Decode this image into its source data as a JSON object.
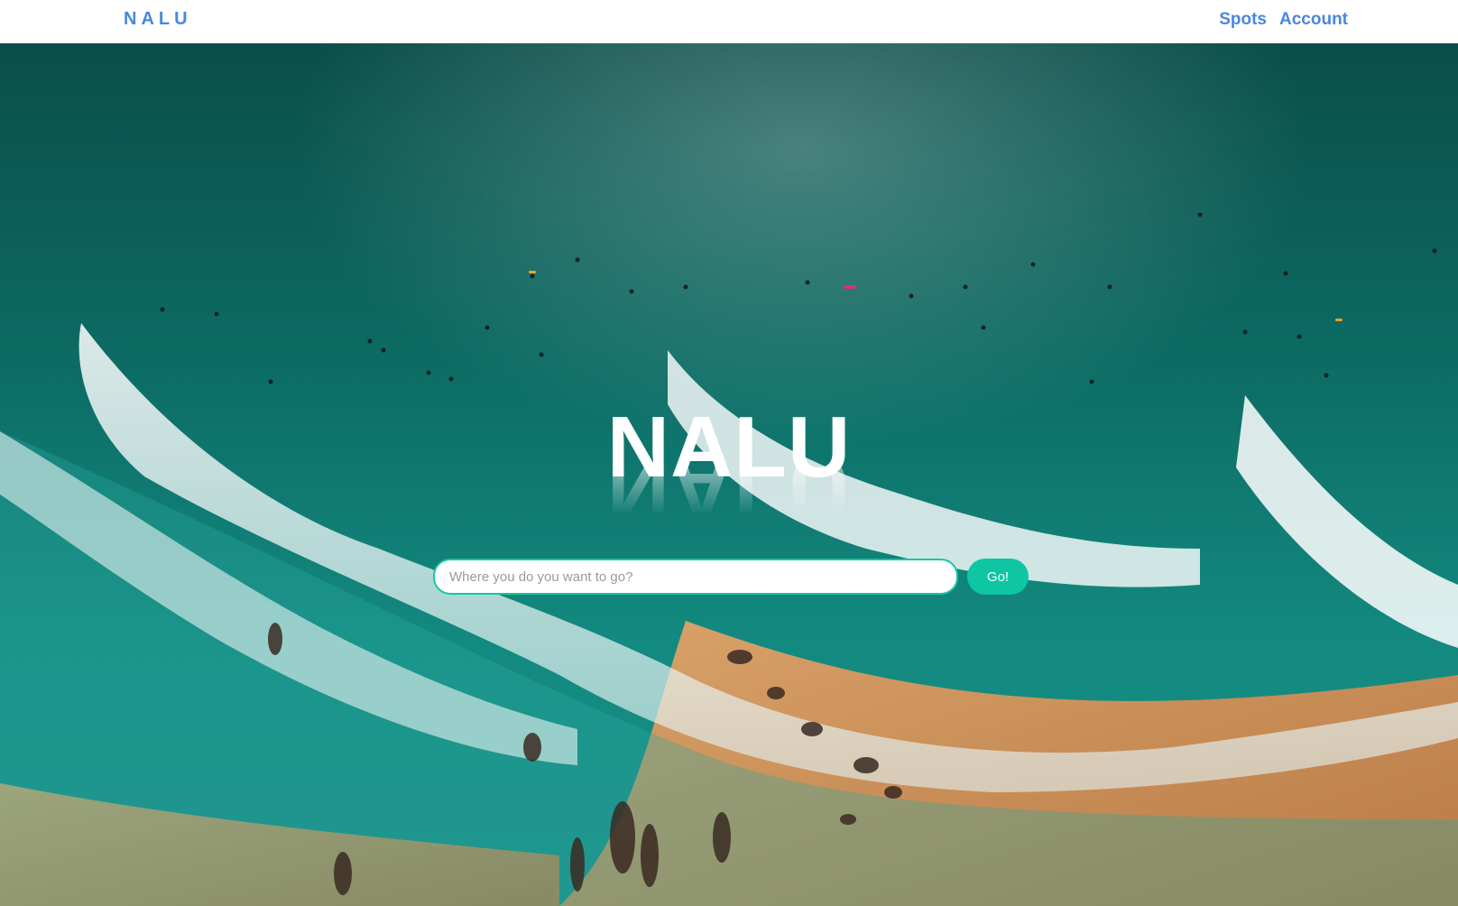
{
  "navbar": {
    "brand": "NALU",
    "links": [
      {
        "label": "Spots"
      },
      {
        "label": "Account"
      }
    ]
  },
  "hero": {
    "title": "NALU",
    "search": {
      "placeholder": "Where you do you want to go?",
      "value": "",
      "button_label": "Go!"
    }
  },
  "colors": {
    "brand": "#4a86e0",
    "accent": "#0ec6a3",
    "ocean": "#0f5f5a",
    "sand": "#c98a52"
  }
}
